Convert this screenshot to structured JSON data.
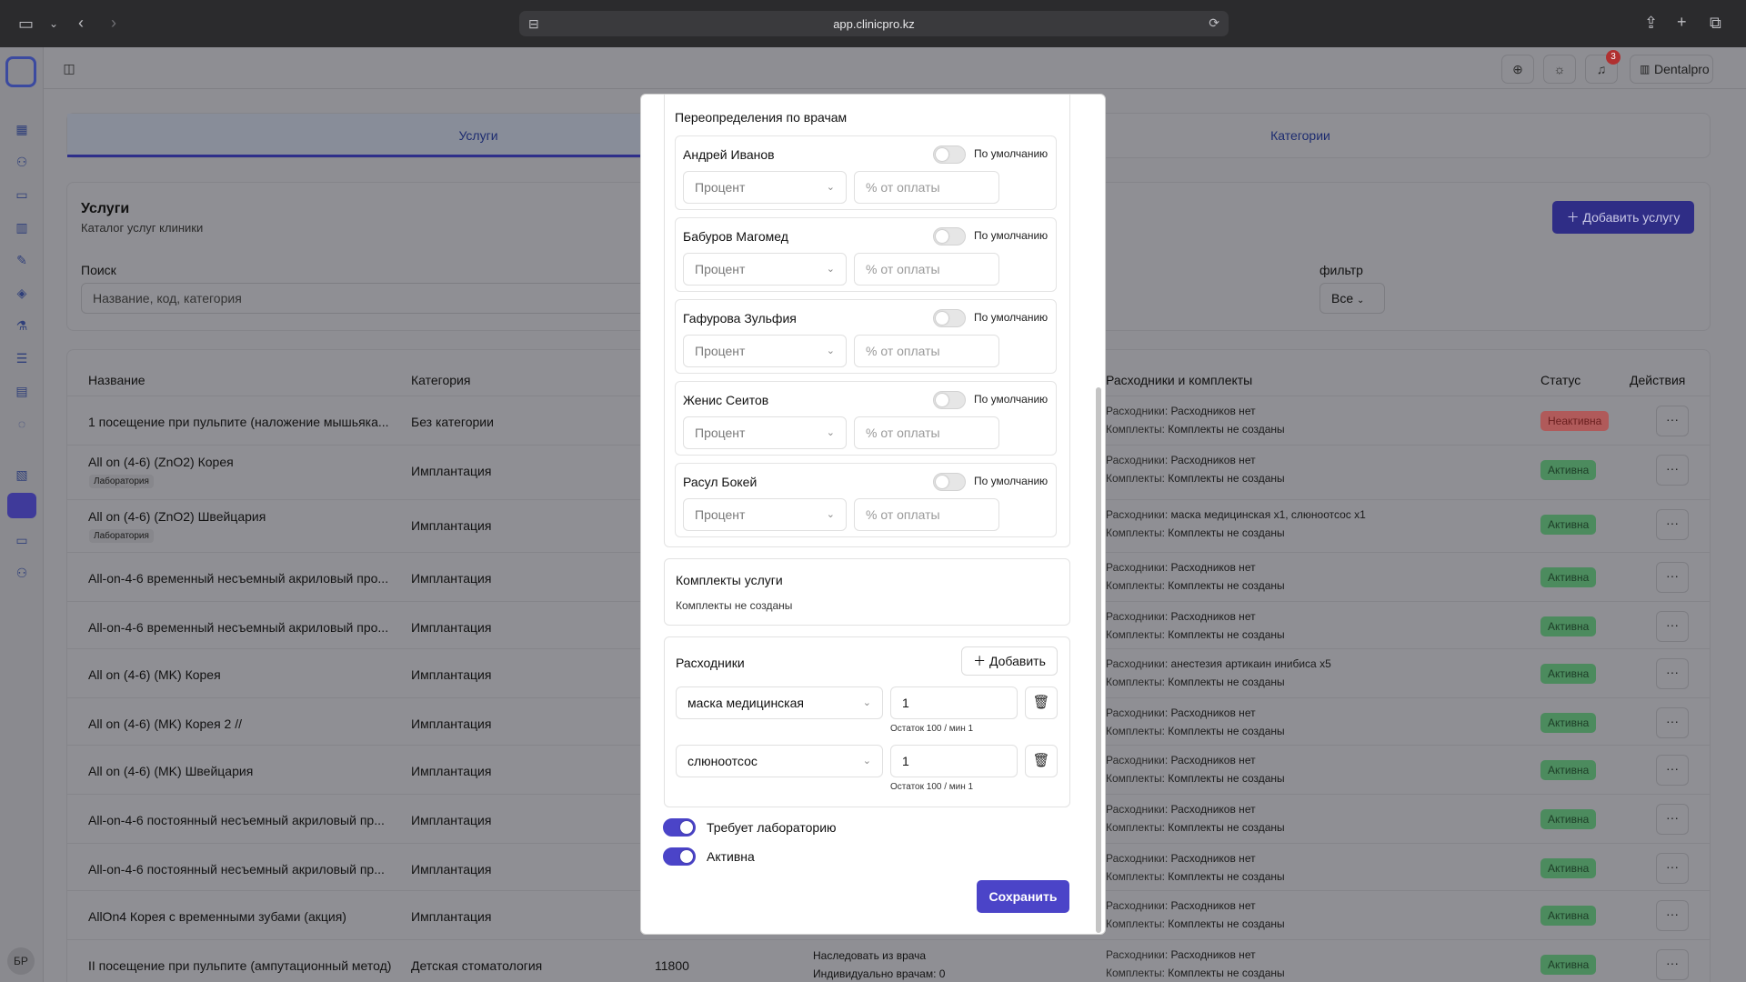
{
  "browser": {
    "url": "app.clinicpro.kz"
  },
  "topbar": {
    "notifications_count": "3",
    "clinic_name": "Dentalpro"
  },
  "sidebar": {
    "avatar_initials": "БР"
  },
  "tabs": [
    {
      "label": "Услуги"
    },
    {
      "label": "Категории"
    }
  ],
  "header": {
    "title": "Услуги",
    "subtitle": "Каталог услуг клиники",
    "search_label": "Поиск",
    "search_placeholder": "Название, код, категория",
    "filter_label": "фильтр",
    "filter_value": "Все",
    "add_button": "Добавить услугу"
  },
  "table": {
    "columns": {
      "name": "Название",
      "category": "Категория",
      "consumables": "Расходники и комплекты",
      "status": "Статус",
      "actions": "Действия"
    },
    "cons_label": "Расходники:",
    "kits_label": "Комплекты:",
    "rows": [
      {
        "name": "1 посещение при пульпите (наложение мышьяка...",
        "category": "Без категории",
        "tag": "",
        "cons": "Расходников нет",
        "kits": "Комплекты не созданы",
        "status": "Неактивна",
        "active": false
      },
      {
        "name": "All on (4-6) (ZnO2) Корея",
        "category": "Имплантация",
        "tag": "Лаборатория",
        "cons": "Расходников нет",
        "kits": "Комплекты не созданы",
        "status": "Активна",
        "active": true
      },
      {
        "name": "All on (4-6) (ZnO2) Швейцария",
        "category": "Имплантация",
        "tag": "Лаборатория",
        "cons": "маска медицинская x1, слюноотсос x1",
        "kits": "Комплекты не созданы",
        "status": "Активна",
        "active": true
      },
      {
        "name": "All-on-4-6 временный несъемный акриловый про...",
        "category": "Имплантация",
        "tag": "",
        "cons": "Расходников нет",
        "kits": "Комплекты не созданы",
        "status": "Активна",
        "active": true
      },
      {
        "name": "All-on-4-6 временный несъемный акриловый про...",
        "category": "Имплантация",
        "tag": "",
        "cons": "Расходников нет",
        "kits": "Комплекты не созданы",
        "status": "Активна",
        "active": true
      },
      {
        "name": "All on (4-6) (MK) Корея",
        "category": "Имплантация",
        "tag": "",
        "cons": "анестезия артикаин инибиса x5",
        "kits": "Комплекты не созданы",
        "status": "Активна",
        "active": true
      },
      {
        "name": "All on (4-6) (MK) Корея 2 //",
        "category": "Имплантация",
        "tag": "",
        "cons": "Расходников нет",
        "kits": "Комплекты не созданы",
        "status": "Активна",
        "active": true
      },
      {
        "name": "All on (4-6) (MK) Швейцария",
        "category": "Имплантация",
        "tag": "",
        "cons": "Расходников нет",
        "kits": "Комплекты не созданы",
        "status": "Активна",
        "active": true
      },
      {
        "name": "All-on-4-6 постоянный несъемный акриловый пр...",
        "category": "Имплантация",
        "tag": "",
        "cons": "Расходников нет",
        "kits": "Комплекты не созданы",
        "status": "Активна",
        "active": true
      },
      {
        "name": "All-on-4-6 постоянный несъемный акриловый пр...",
        "category": "Имплантация",
        "tag": "",
        "cons": "Расходников нет",
        "kits": "Комплекты не созданы",
        "status": "Активна",
        "active": true
      },
      {
        "name": "AllOn4 Корея с временными зубами (акция)",
        "category": "Имплантация",
        "tag": "",
        "cons": "Расходников нет",
        "kits": "Комплекты не созданы",
        "status": "Активна",
        "active": true
      },
      {
        "name": "II посещение при пульпите (ампутационный метод)",
        "category": "Детская стоматология",
        "tag": "",
        "price": "11800",
        "inherit": "Наследовать из врача",
        "inherit_sub": "Индивидуально врачам: 0",
        "cons": "Расходников нет",
        "kits": "Комплекты не созданы",
        "status": "Активна",
        "active": true
      }
    ]
  },
  "modal": {
    "overrides_title": "Переопределения по врачам",
    "default_label": "По умолчанию",
    "type_placeholder": "Процент",
    "pct_placeholder": "% от оплаты",
    "doctors": [
      "Андрей Иванов",
      "Бабуров Магомед",
      "Гафурова Зульфия",
      "Женис Сеитов",
      "Расул Бокей"
    ],
    "kits_title": "Комплекты услуги",
    "kits_empty": "Комплекты не созданы",
    "consumables_title": "Расходники",
    "add_label": "Добавить",
    "consumables": [
      {
        "name": "маска медицинская",
        "qty": "1",
        "rest": "Остаток 100 / мин 1"
      },
      {
        "name": "слюноотсос",
        "qty": "1",
        "rest": "Остаток 100 / мин 1"
      }
    ],
    "requires_lab": "Требует лабораторию",
    "active": "Активна",
    "save": "Сохранить"
  }
}
